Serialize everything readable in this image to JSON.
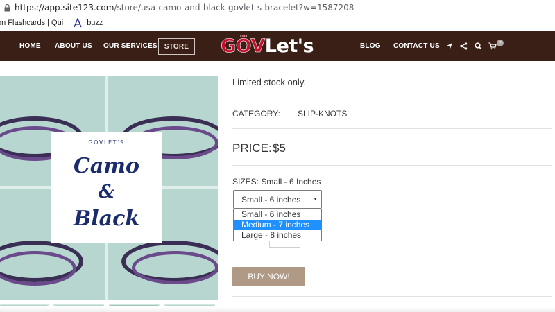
{
  "browser": {
    "url_host": "https://app.site123.com",
    "url_path": "/store/usa-camo-and-black-govlet-s-bracelet?w=1587208",
    "bookmarks": [
      {
        "label": "on Flashcards | Qui"
      },
      {
        "label": "buzz"
      }
    ]
  },
  "navbar": {
    "home": "HOME",
    "about": "ABOUT US",
    "services": "OUR SERVICES",
    "store": "STORE",
    "logo_red": "GÖV",
    "logo_white": "Let's",
    "blog": "BLOG",
    "contact": "CONTACT US",
    "cart_count": "2",
    "colors": {
      "bar": "#3a1f16",
      "logo_red": "#c8102e"
    }
  },
  "product_image": {
    "card_brand": "GOVLET'S",
    "card_line1": "Camo",
    "card_line2": "&",
    "card_line3": "Black"
  },
  "product": {
    "stock_note": "Limited stock only.",
    "category_label": "CATEGORY:",
    "category_value": "SLIP-KNOTS",
    "price_label": "PRICE:",
    "price_value": "$5",
    "sizes_label": "SIZES: Small - 6 Inches",
    "selected_size": "Small - 6 inches",
    "size_options": [
      "Small - 6 inches",
      "Medium - 7 inches",
      "Large - 8 inches"
    ],
    "highlighted_option_index": 1,
    "buy_label": "BUY NOW!",
    "accent_color": "#1e90ff",
    "buy_color": "#b09a86"
  }
}
